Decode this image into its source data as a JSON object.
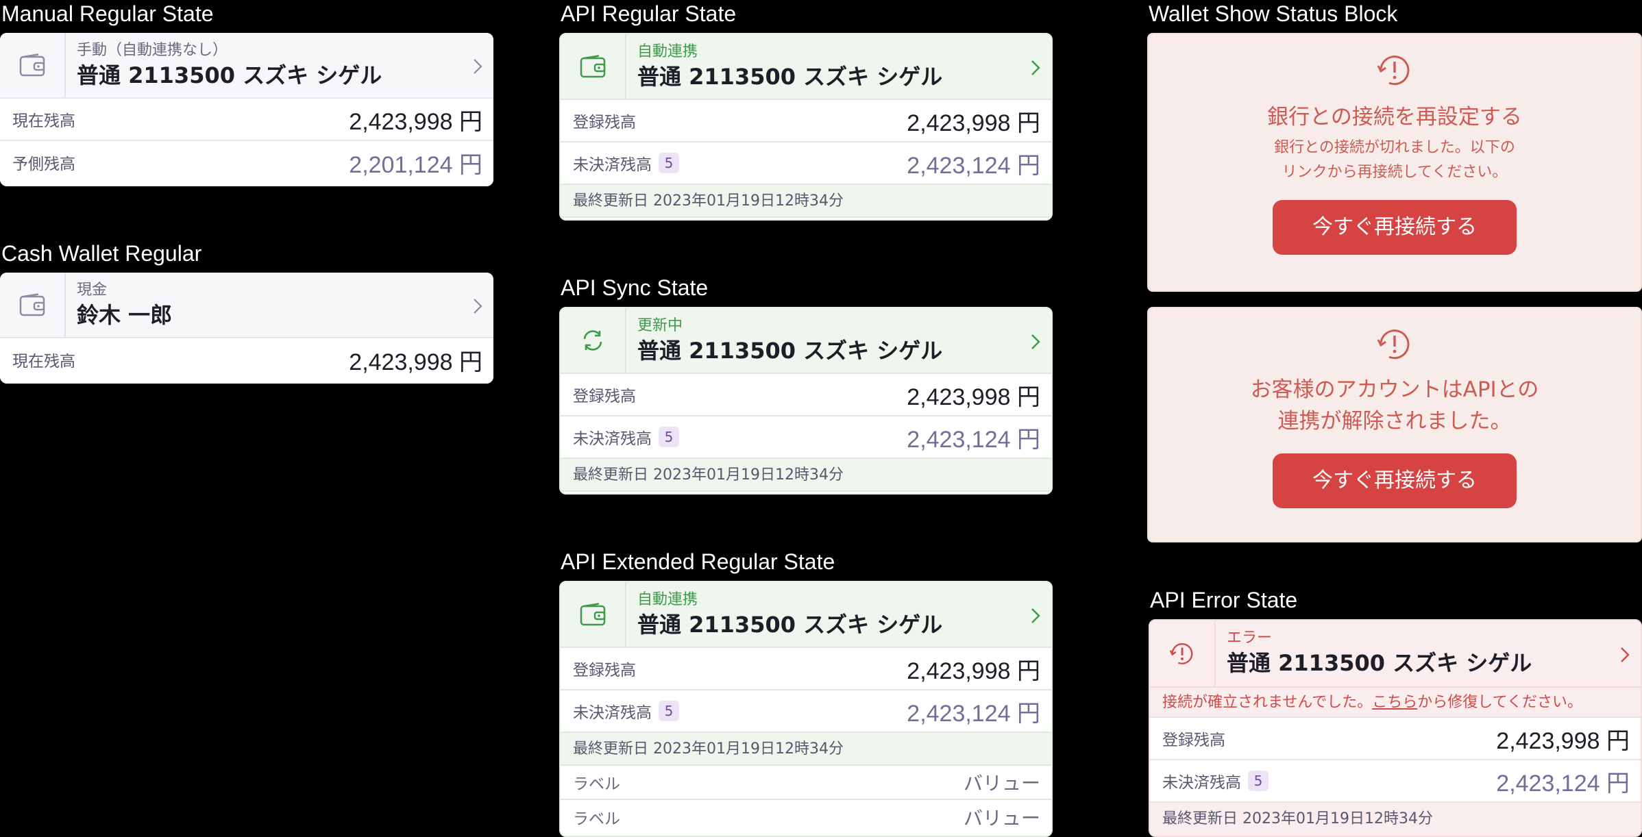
{
  "sections": {
    "manual": "Manual Regular State",
    "cash": "Cash Wallet Regular",
    "api_regular": "API Regular State",
    "api_sync": "API Sync State",
    "api_extended": "API Extended Regular State",
    "wallet_status": "Wallet Show Status Block",
    "api_error": "API Error State"
  },
  "manual_card": {
    "subtitle": "手動（自動連携なし）",
    "title": "普通 2113500 スズキ シゲル",
    "rows": [
      {
        "label": "現在残高",
        "value": "2,423,998",
        "unit": "円"
      },
      {
        "label": "予側残高",
        "value": "2,201,124",
        "unit": "円"
      }
    ]
  },
  "cash_card": {
    "subtitle": "現金",
    "title": "鈴木 一郎",
    "rows": [
      {
        "label": "現在残高",
        "value": "2,423,998",
        "unit": "円"
      }
    ]
  },
  "api_regular_card": {
    "subtitle": "自動連携",
    "title": "普通 2113500 スズキ シゲル",
    "balance_label": "登録残高",
    "balance_value": "2,423,998",
    "unit": "円",
    "pending_label": "未決済残高",
    "pending_count": "5",
    "pending_value": "2,423,124",
    "updated": "最終更新日 2023年01月19日12時34分"
  },
  "api_sync_card": {
    "subtitle": "更新中",
    "title": "普通 2113500 スズキ シゲル",
    "balance_label": "登録残高",
    "balance_value": "2,423,998",
    "unit": "円",
    "pending_label": "未決済残高",
    "pending_count": "5",
    "pending_value": "2,423,124",
    "updated": "最終更新日 2023年01月19日12時34分"
  },
  "api_extended_card": {
    "subtitle": "自動連携",
    "title": "普通 2113500 スズキ シゲル",
    "balance_label": "登録残高",
    "balance_value": "2,423,998",
    "unit": "円",
    "pending_label": "未決済残高",
    "pending_count": "5",
    "pending_value": "2,423,124",
    "updated": "最終更新日 2023年01月19日12時34分",
    "extra_rows": [
      {
        "label": "ラベル",
        "value": "バリュー"
      },
      {
        "label": "ラベル",
        "value": "バリュー"
      }
    ]
  },
  "status_block_1": {
    "title": "銀行との接続を再設定する",
    "desc_line1": "銀行との接続が切れました。以下の",
    "desc_line2": "リンクから再接続してください。",
    "button": "今すぐ再接続する"
  },
  "status_block_2": {
    "title_line1": "お客様のアカウントはAPIとの",
    "title_line2": "連携が解除されました。",
    "button": "今すぐ再接続する"
  },
  "api_error_card": {
    "subtitle": "エラー",
    "title": "普通 2113500 スズキ シゲル",
    "error_pre": "接続が確立されませんでした。",
    "error_link": "こちら",
    "error_post": "から修復してください。",
    "balance_label": "登録残高",
    "balance_value": "2,423,998",
    "unit": "円",
    "pending_label": "未決済残高",
    "pending_count": "5",
    "pending_value": "2,423,124",
    "updated": "最終更新日 2023年01月19日12時34分"
  },
  "colors": {
    "api_green": "#3f9a4a",
    "error_red": "#d24a4a",
    "button_red": "#d64343",
    "pending_badge": "#ece4f6"
  },
  "icons": [
    "wallet-icon",
    "sync-icon",
    "alert-sync-icon",
    "chevron-right-icon"
  ]
}
